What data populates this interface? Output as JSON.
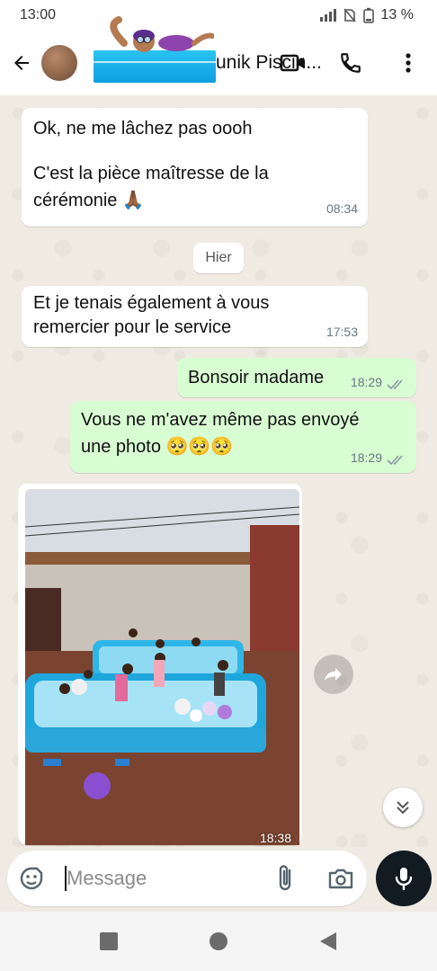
{
  "status_bar": {
    "time": "13:00",
    "battery": "13 %"
  },
  "header": {
    "contact_name": "unik Piscin..."
  },
  "messages": {
    "m1": {
      "line1": "Ok, ne me lâchez pas oooh",
      "line2": "C'est la pièce maîtresse de la",
      "line3": "cérémonie 🙏🏾",
      "time": "08:34"
    },
    "day_separator": "Hier",
    "m2": {
      "line1": "Et je tenais également à vous",
      "line2": "remercier pour le service",
      "time": "17:53"
    },
    "m3": {
      "text": "Bonsoir madame",
      "time": "18:29"
    },
    "m4": {
      "line1": "Vous ne m'avez même pas envoyé",
      "line2": "une photo 🥺🥺🥺",
      "time": "18:29"
    },
    "m5": {
      "time": "18:38"
    }
  },
  "composer": {
    "placeholder": "Message"
  },
  "colors": {
    "incoming": "#ffffff",
    "outgoing": "#d9fdd3",
    "background": "#efeae2",
    "read_ticks": "#8a9aa3"
  },
  "icons": [
    "back-arrow-icon",
    "video-call-icon",
    "phone-icon",
    "more-vert-icon",
    "double-check-icon",
    "forward-icon",
    "chevron-double-down-icon",
    "sticker-icon",
    "attach-icon",
    "camera-icon",
    "mic-icon",
    "nav-recents-icon",
    "nav-home-icon",
    "nav-back-icon"
  ]
}
